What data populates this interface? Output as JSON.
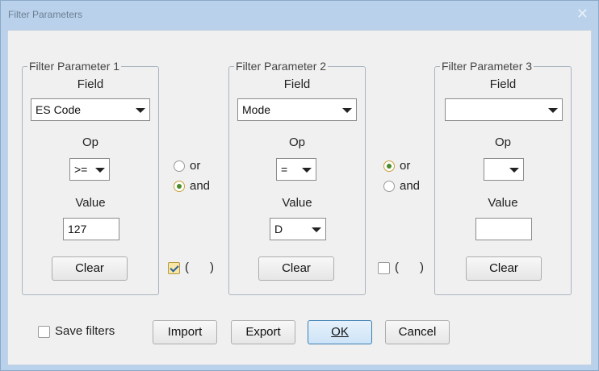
{
  "window": {
    "title": "Filter Parameters",
    "close_glyph": "✕"
  },
  "groups": [
    {
      "legend": "Filter Parameter 1",
      "field_label": "Field",
      "field_value": "ES Code",
      "op_label": "Op",
      "op_value": ">=",
      "value_label": "Value",
      "value": "127",
      "value_type": "textbox",
      "clear_label": "Clear"
    },
    {
      "legend": "Filter Parameter 2",
      "field_label": "Field",
      "field_value": "Mode",
      "op_label": "Op",
      "op_value": "=",
      "value_label": "Value",
      "value": "D",
      "value_type": "combo",
      "clear_label": "Clear"
    },
    {
      "legend": "Filter Parameter 3",
      "field_label": "Field",
      "field_value": "",
      "op_label": "Op",
      "op_value": "",
      "value_label": "Value",
      "value": "",
      "value_type": "textbox",
      "clear_label": "Clear"
    }
  ],
  "connectors": [
    {
      "or_label": "or",
      "and_label": "and",
      "selected": "and",
      "paren_open": "(",
      "paren_close": ")",
      "paren_checked": true
    },
    {
      "or_label": "or",
      "and_label": "and",
      "selected": "or",
      "paren_open": "(",
      "paren_close": ")",
      "paren_checked": false
    }
  ],
  "footer": {
    "save_filters_label": "Save filters",
    "save_filters_checked": false,
    "import_label": "Import",
    "export_label": "Export",
    "ok_label": "OK",
    "cancel_label": "Cancel"
  }
}
